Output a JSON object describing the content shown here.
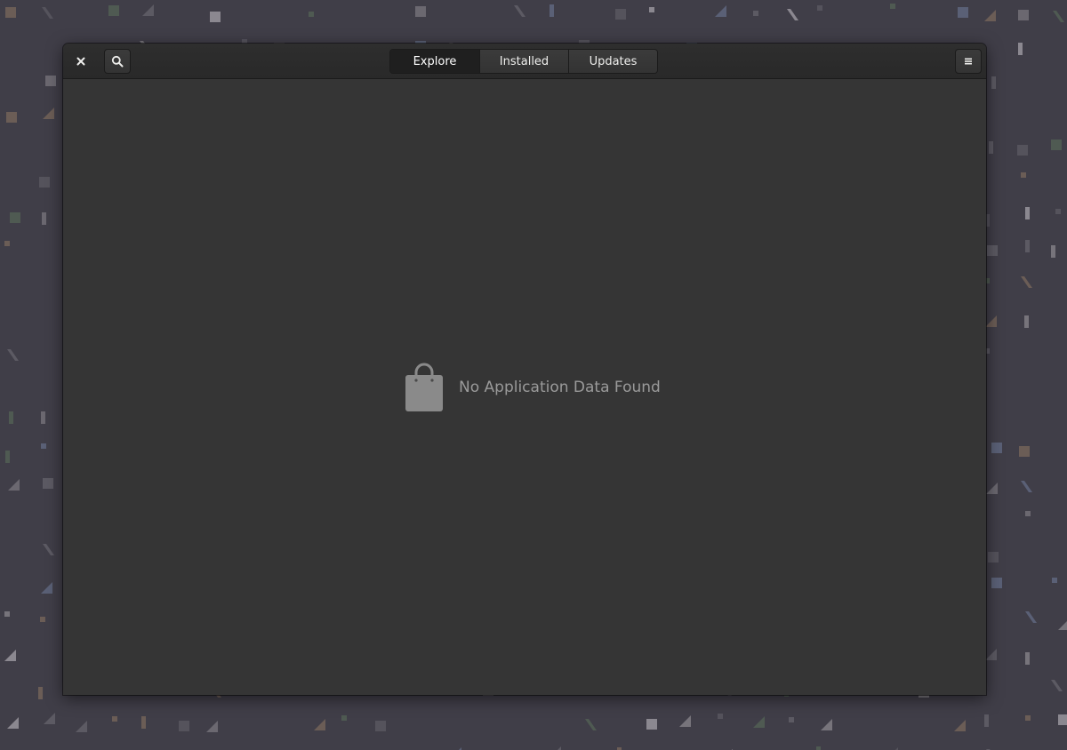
{
  "window": {
    "close_icon": "close-icon",
    "search_icon": "search-icon",
    "menu_icon": "hamburger-menu-icon"
  },
  "tabs": [
    {
      "label": "Explore",
      "active": true
    },
    {
      "label": "Installed",
      "active": false
    },
    {
      "label": "Updates",
      "active": false
    }
  ],
  "empty_state": {
    "icon": "shopping-bag-icon",
    "message": "No Application Data Found"
  },
  "colors": {
    "desktop": "#403e48",
    "window_bg": "#353535",
    "headerbar": "#2b2b2b",
    "active_tab": "#1f1f1f",
    "empty_text": "#9a9a9a"
  }
}
